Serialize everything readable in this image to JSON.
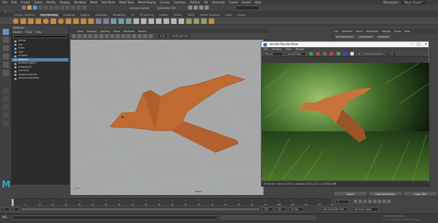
{
  "menubar": [
    "File",
    "Edit",
    "Create",
    "Select",
    "Modify",
    "Display",
    "Windows",
    "Mesh",
    "Edit Mesh",
    "Mesh Tools",
    "Mesh Display",
    "Curves",
    "Surfaces",
    "Deform",
    "UV",
    "Generate",
    "Cache",
    "Arnold",
    "Help"
  ],
  "workspace": {
    "label": "Workspace :",
    "value": "Maya Classic*"
  },
  "status_line": {
    "mode": "Modeling",
    "live_surface": "No Live Surface",
    "symmetry": "Symmetry: Off"
  },
  "shelf_tabs": [
    "Curves / Surfaces",
    "Poly Modeling",
    "Sculpting",
    "Rigging",
    "Animation",
    "Rendering",
    "FX",
    "FX Caching",
    "Custom",
    "Bifrost",
    "MASH",
    "Motion Graphics",
    "XGen",
    "Arnold"
  ],
  "shelf_active": "Poly Modeling",
  "outliner": {
    "title": "Outliner",
    "menu": [
      "Display",
      "Show",
      "Help"
    ],
    "items": [
      {
        "label": "persp"
      },
      {
        "label": "top"
      },
      {
        "label": "front"
      },
      {
        "label": "side"
      },
      {
        "label": "pCube1"
      },
      {
        "label": "pPlane1",
        "selected": true
      },
      {
        "label": "ambientLight1"
      },
      {
        "label": "areaLight2"
      },
      {
        "label": "camera1"
      },
      {
        "label": "defaultLightSet"
      },
      {
        "label": "defaultObjectSet"
      }
    ]
  },
  "viewport": {
    "menu": [
      "View",
      "Shading",
      "Lighting",
      "Show",
      "Renderer",
      "Panels"
    ],
    "camera_label": "persp",
    "color_space": "sRGB gamma",
    "gamma_value": "1.00"
  },
  "render_view": {
    "title": "Arnold RenderView",
    "menu": [
      "File",
      "Window",
      "View",
      "Render"
    ],
    "aov": "Beauty",
    "camera": "perspShape",
    "exposure": "0",
    "gamma": "1.00",
    "status": "00:00:10 | Own'12 (T:?) | samples 3/3/1/1/1/1 | 2105.84 MB"
  },
  "attribute_editor": {
    "tabs": [
      "List",
      "Selected",
      "Focus",
      "Attributes",
      "Display",
      "Show",
      "Help"
    ],
    "node_tabs": [
      "pPlaneShape1",
      "polyPlane1",
      "lambert1"
    ],
    "buttons": [
      "Select",
      "Load Attributes",
      "Copy Tab"
    ]
  },
  "time_slider": {
    "ticks": [
      5,
      10,
      15,
      20,
      25,
      30,
      35,
      40,
      45,
      50,
      55,
      60,
      65,
      70,
      75,
      80,
      85,
      90,
      95,
      100,
      105,
      110,
      115,
      120
    ],
    "current_frame": "1"
  },
  "range_slider": {
    "start": "1",
    "inner_start": "1",
    "inner_end": "120",
    "end": "120",
    "fps": "24 fps"
  },
  "command_line": {
    "lang": "MEL",
    "character_set": "No Character Set",
    "anim_layer": "No Anim Layer"
  },
  "watermark": {
    "line1": "Activate Windows",
    "line2": "Go to Settings to activate Windows."
  },
  "maya_logo": "M"
}
